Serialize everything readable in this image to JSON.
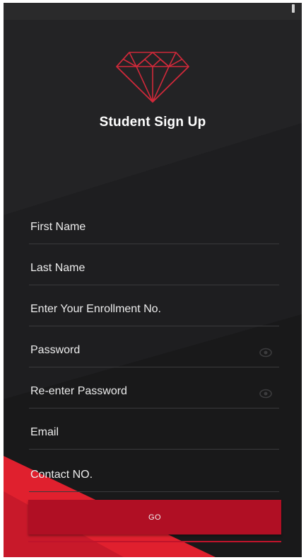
{
  "header": {
    "logo_icon": "diamond-icon",
    "title": "Student Sign Up"
  },
  "form": {
    "first_name": {
      "label": "First Name"
    },
    "last_name": {
      "label": "Last Name"
    },
    "enrollment": {
      "label": "Enter Your Enrollment No."
    },
    "password": {
      "label": "Password",
      "icon": "eye-icon"
    },
    "reenter_password": {
      "label": "Re-enter Password",
      "icon": "eye-icon"
    },
    "email": {
      "label": "Email"
    },
    "contact": {
      "label": "Contact NO."
    },
    "submit_label": "GO"
  },
  "colors": {
    "background": "#1b1b1c",
    "accent": "#b00f24",
    "accent_bright": "#e0202e",
    "text": "#ffffff"
  }
}
